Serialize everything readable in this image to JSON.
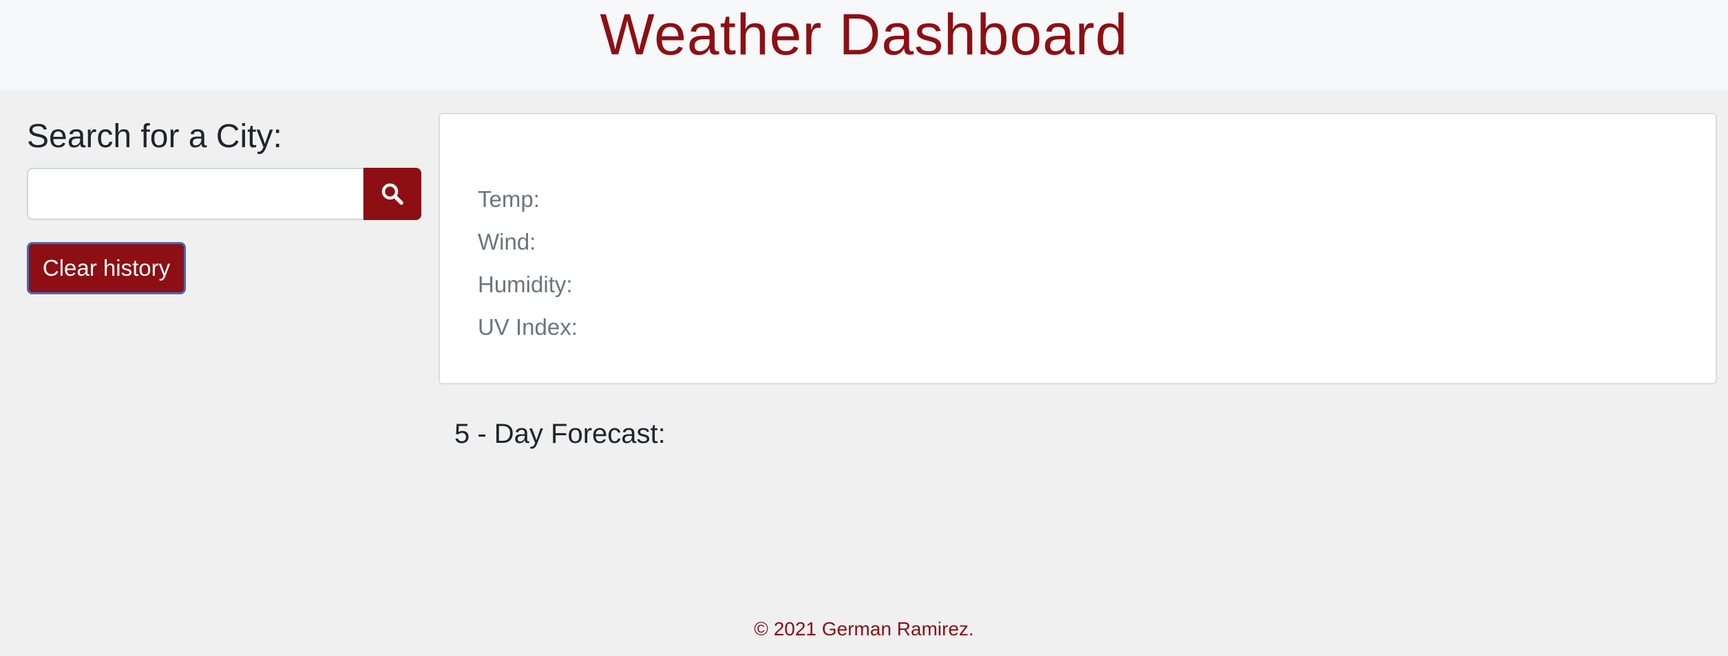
{
  "header": {
    "title": "Weather Dashboard"
  },
  "sidebar": {
    "search_heading": "Search for a City:",
    "search_input_value": "",
    "search_button_icon": "search-icon",
    "clear_label": "Clear history"
  },
  "current": {
    "city_title": "",
    "stats": [
      {
        "label": "Temp:",
        "value": ""
      },
      {
        "label": "Wind:",
        "value": ""
      },
      {
        "label": "Humidity:",
        "value": ""
      },
      {
        "label": "UV Index:",
        "value": ""
      }
    ]
  },
  "forecast": {
    "heading": "5 - Day Forecast:",
    "days": []
  },
  "footer": {
    "text": "© 2021 German Ramirez."
  },
  "colors": {
    "accent": "#8d0f14",
    "page_background": "#f0f0f0",
    "header_background": "#f7f8f9",
    "stat_text": "#6c757d",
    "focus_outline": "#4a68b7"
  }
}
